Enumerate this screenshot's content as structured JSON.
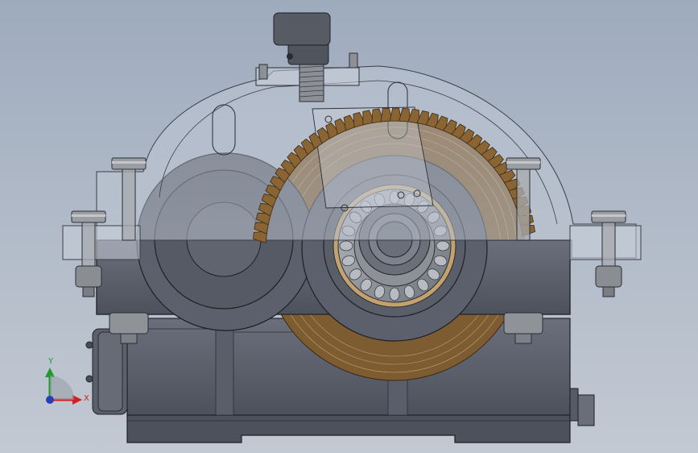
{
  "viewport": {
    "background_top": "#9eabbd",
    "background_bottom": "#c2c9d3"
  },
  "model": {
    "housing_color": "#5c606c",
    "transparent_cover_color": "#c8d0dc",
    "gear_color": "#8a6432",
    "bolt_color": "#8f9296",
    "breather_color": "#575b63"
  },
  "triad": {
    "x_label": "X",
    "y_label": "Y",
    "x_color": "#d21f1f",
    "y_color": "#1f9a2e",
    "z_color": "#2a3db8"
  }
}
